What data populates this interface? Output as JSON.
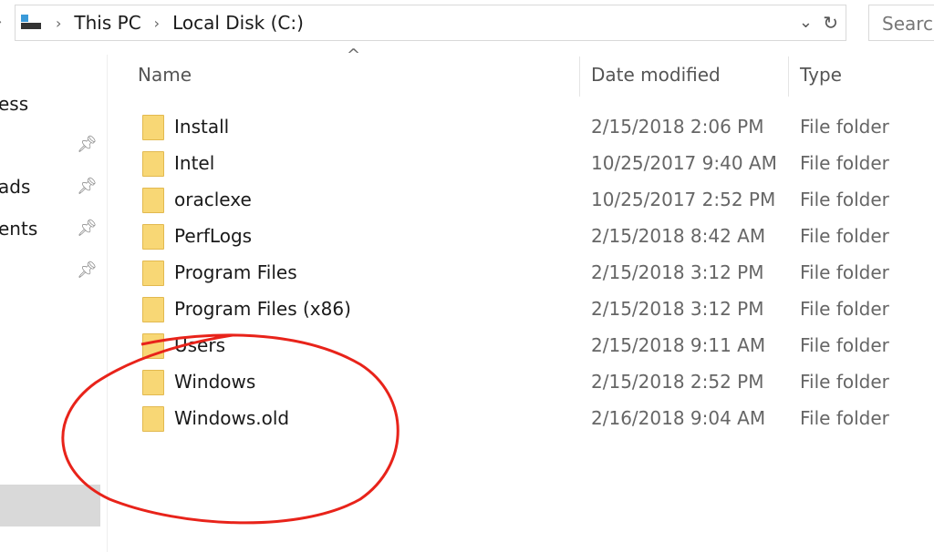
{
  "address": {
    "crumbs": [
      "This PC",
      "Local Disk (C:)"
    ],
    "search_placeholder": "Search"
  },
  "nav": {
    "items": [
      "ess",
      "ads",
      "ents"
    ]
  },
  "columns": {
    "name": "Name",
    "date": "Date modified",
    "type": "Type"
  },
  "files": [
    {
      "name": "Install",
      "date": "2/15/2018 2:06 PM",
      "type": "File folder"
    },
    {
      "name": "Intel",
      "date": "10/25/2017 9:40 AM",
      "type": "File folder"
    },
    {
      "name": "oraclexe",
      "date": "10/25/2017 2:52 PM",
      "type": "File folder"
    },
    {
      "name": "PerfLogs",
      "date": "2/15/2018 8:42 AM",
      "type": "File folder"
    },
    {
      "name": "Program Files",
      "date": "2/15/2018 3:12 PM",
      "type": "File folder"
    },
    {
      "name": "Program Files (x86)",
      "date": "2/15/2018 3:12 PM",
      "type": "File folder"
    },
    {
      "name": "Users",
      "date": "2/15/2018 9:11 AM",
      "type": "File folder"
    },
    {
      "name": "Windows",
      "date": "2/15/2018 2:52 PM",
      "type": "File folder"
    },
    {
      "name": "Windows.old",
      "date": "2/16/2018 9:04 AM",
      "type": "File folder"
    }
  ],
  "annotation_color": "#e8231a"
}
